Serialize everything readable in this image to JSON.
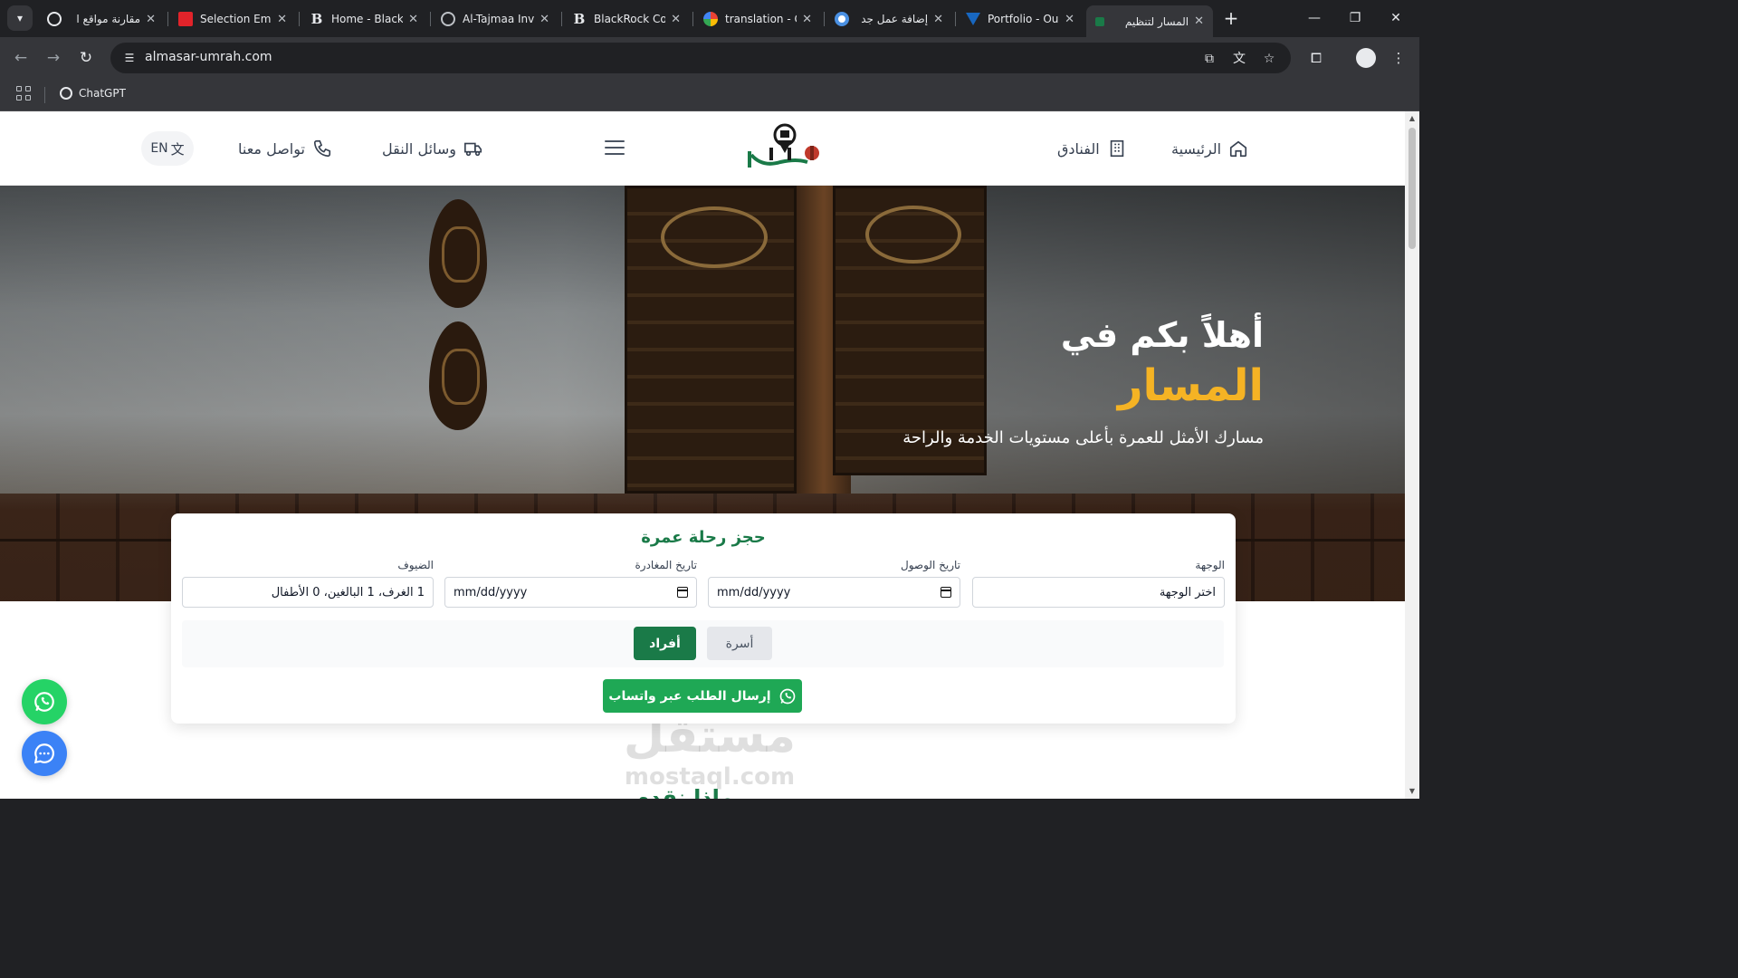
{
  "browser": {
    "tabs": [
      {
        "title": "مقارنة مواقع ا",
        "favicon": "chatgpt-icon",
        "active": false
      },
      {
        "title": "Selection Emb",
        "favicon": "zoho-icon",
        "active": false
      },
      {
        "title": "Home - Black",
        "favicon": "b-letter-icon",
        "active": false
      },
      {
        "title": "Al-Tajmaa Inv",
        "favicon": "globe-icon",
        "active": false
      },
      {
        "title": "BlackRock Co",
        "favicon": "b-letter-icon",
        "active": false
      },
      {
        "title": "translation - G",
        "favicon": "google-icon",
        "active": false
      },
      {
        "title": "إضافة عمل جد",
        "favicon": "circle-icon",
        "active": false
      },
      {
        "title": "Portfolio - Ou",
        "favicon": "vuetify-icon",
        "active": false
      },
      {
        "title": "المسار لتنظيم",
        "favicon": "site-icon",
        "active": true
      }
    ],
    "url": "almasar-umrah.com",
    "bookmarks": [
      {
        "label": "ChatGPT",
        "icon": "chatgpt-icon"
      }
    ]
  },
  "header": {
    "nav": {
      "home": "الرئيسية",
      "hotels": "الفنادق",
      "transport": "وسائل النقل",
      "contact": "تواصل معنا"
    },
    "lang_button": "EN",
    "logo_alt": "المسار"
  },
  "hero": {
    "title": "أهلاً بكم في",
    "brand": "المسار",
    "subtitle": "مسارك الأمثل للعمرة بأعلى مستويات الخدمة والراحة"
  },
  "booking": {
    "title": "حجز رحلة عمرة",
    "fields": {
      "destination": {
        "label": "الوجهة",
        "value": "اختر الوجهة"
      },
      "arrival": {
        "label": "تاريخ الوصول",
        "value": "mm/dd/yyyy"
      },
      "departure": {
        "label": "تاريخ المغادرة",
        "value": "mm/dd/yyyy"
      },
      "guests": {
        "label": "الضيوف",
        "value": "1 الغرف، 1 البالغين، 0 الأطفال"
      }
    },
    "types": {
      "individuals": "أفراد",
      "family": "أسرة"
    },
    "submit": "إرسال الطلب عبر واتساب"
  },
  "watermark": {
    "arabic": "مستقل",
    "english": "mostaql.com"
  },
  "next_section_heading": "ماذا نقدم",
  "colors": {
    "brand_green": "#1a7a48",
    "accent_gold": "#f5b324",
    "whatsapp": "#25d366",
    "chat_blue": "#3b82f6"
  }
}
